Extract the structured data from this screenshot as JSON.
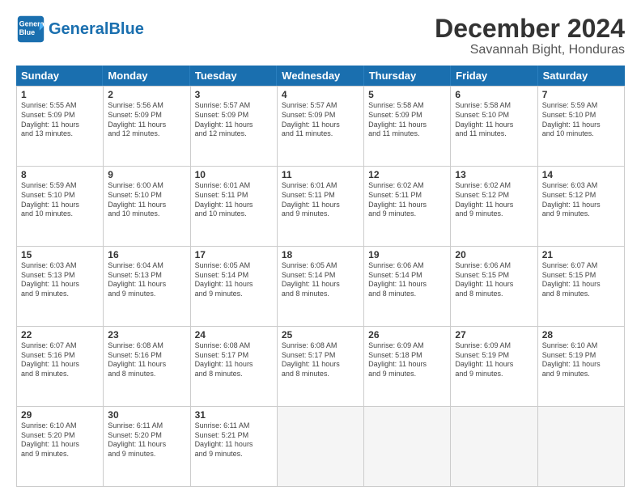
{
  "logo": {
    "text_general": "General",
    "text_blue": "Blue"
  },
  "title": "December 2024",
  "location": "Savannah Bight, Honduras",
  "days_of_week": [
    "Sunday",
    "Monday",
    "Tuesday",
    "Wednesday",
    "Thursday",
    "Friday",
    "Saturday"
  ],
  "weeks": [
    [
      {
        "day": "1",
        "info": "Sunrise: 5:55 AM\nSunset: 5:09 PM\nDaylight: 11 hours\nand 13 minutes."
      },
      {
        "day": "2",
        "info": "Sunrise: 5:56 AM\nSunset: 5:09 PM\nDaylight: 11 hours\nand 12 minutes."
      },
      {
        "day": "3",
        "info": "Sunrise: 5:57 AM\nSunset: 5:09 PM\nDaylight: 11 hours\nand 12 minutes."
      },
      {
        "day": "4",
        "info": "Sunrise: 5:57 AM\nSunset: 5:09 PM\nDaylight: 11 hours\nand 11 minutes."
      },
      {
        "day": "5",
        "info": "Sunrise: 5:58 AM\nSunset: 5:09 PM\nDaylight: 11 hours\nand 11 minutes."
      },
      {
        "day": "6",
        "info": "Sunrise: 5:58 AM\nSunset: 5:10 PM\nDaylight: 11 hours\nand 11 minutes."
      },
      {
        "day": "7",
        "info": "Sunrise: 5:59 AM\nSunset: 5:10 PM\nDaylight: 11 hours\nand 10 minutes."
      }
    ],
    [
      {
        "day": "8",
        "info": "Sunrise: 5:59 AM\nSunset: 5:10 PM\nDaylight: 11 hours\nand 10 minutes."
      },
      {
        "day": "9",
        "info": "Sunrise: 6:00 AM\nSunset: 5:10 PM\nDaylight: 11 hours\nand 10 minutes."
      },
      {
        "day": "10",
        "info": "Sunrise: 6:01 AM\nSunset: 5:11 PM\nDaylight: 11 hours\nand 10 minutes."
      },
      {
        "day": "11",
        "info": "Sunrise: 6:01 AM\nSunset: 5:11 PM\nDaylight: 11 hours\nand 9 minutes."
      },
      {
        "day": "12",
        "info": "Sunrise: 6:02 AM\nSunset: 5:11 PM\nDaylight: 11 hours\nand 9 minutes."
      },
      {
        "day": "13",
        "info": "Sunrise: 6:02 AM\nSunset: 5:12 PM\nDaylight: 11 hours\nand 9 minutes."
      },
      {
        "day": "14",
        "info": "Sunrise: 6:03 AM\nSunset: 5:12 PM\nDaylight: 11 hours\nand 9 minutes."
      }
    ],
    [
      {
        "day": "15",
        "info": "Sunrise: 6:03 AM\nSunset: 5:13 PM\nDaylight: 11 hours\nand 9 minutes."
      },
      {
        "day": "16",
        "info": "Sunrise: 6:04 AM\nSunset: 5:13 PM\nDaylight: 11 hours\nand 9 minutes."
      },
      {
        "day": "17",
        "info": "Sunrise: 6:05 AM\nSunset: 5:14 PM\nDaylight: 11 hours\nand 9 minutes."
      },
      {
        "day": "18",
        "info": "Sunrise: 6:05 AM\nSunset: 5:14 PM\nDaylight: 11 hours\nand 8 minutes."
      },
      {
        "day": "19",
        "info": "Sunrise: 6:06 AM\nSunset: 5:14 PM\nDaylight: 11 hours\nand 8 minutes."
      },
      {
        "day": "20",
        "info": "Sunrise: 6:06 AM\nSunset: 5:15 PM\nDaylight: 11 hours\nand 8 minutes."
      },
      {
        "day": "21",
        "info": "Sunrise: 6:07 AM\nSunset: 5:15 PM\nDaylight: 11 hours\nand 8 minutes."
      }
    ],
    [
      {
        "day": "22",
        "info": "Sunrise: 6:07 AM\nSunset: 5:16 PM\nDaylight: 11 hours\nand 8 minutes."
      },
      {
        "day": "23",
        "info": "Sunrise: 6:08 AM\nSunset: 5:16 PM\nDaylight: 11 hours\nand 8 minutes."
      },
      {
        "day": "24",
        "info": "Sunrise: 6:08 AM\nSunset: 5:17 PM\nDaylight: 11 hours\nand 8 minutes."
      },
      {
        "day": "25",
        "info": "Sunrise: 6:08 AM\nSunset: 5:17 PM\nDaylight: 11 hours\nand 8 minutes."
      },
      {
        "day": "26",
        "info": "Sunrise: 6:09 AM\nSunset: 5:18 PM\nDaylight: 11 hours\nand 9 minutes."
      },
      {
        "day": "27",
        "info": "Sunrise: 6:09 AM\nSunset: 5:19 PM\nDaylight: 11 hours\nand 9 minutes."
      },
      {
        "day": "28",
        "info": "Sunrise: 6:10 AM\nSunset: 5:19 PM\nDaylight: 11 hours\nand 9 minutes."
      }
    ],
    [
      {
        "day": "29",
        "info": "Sunrise: 6:10 AM\nSunset: 5:20 PM\nDaylight: 11 hours\nand 9 minutes."
      },
      {
        "day": "30",
        "info": "Sunrise: 6:11 AM\nSunset: 5:20 PM\nDaylight: 11 hours\nand 9 minutes."
      },
      {
        "day": "31",
        "info": "Sunrise: 6:11 AM\nSunset: 5:21 PM\nDaylight: 11 hours\nand 9 minutes."
      },
      {
        "day": "",
        "info": ""
      },
      {
        "day": "",
        "info": ""
      },
      {
        "day": "",
        "info": ""
      },
      {
        "day": "",
        "info": ""
      }
    ]
  ]
}
